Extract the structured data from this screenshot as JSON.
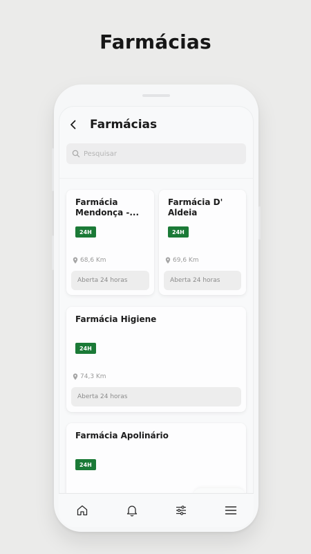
{
  "headline": "Farmácias",
  "app": {
    "title": "Farmácias",
    "search": {
      "placeholder": "Pesquisar",
      "value": ""
    }
  },
  "pharmacies": [
    {
      "name_line1": "Farmácia",
      "name_line2": "Mendonça -...",
      "badge": "24H",
      "distance": "68,6 Km",
      "status": "Aberta 24 horas"
    },
    {
      "name_line1": "Farmácia D'",
      "name_line2": "Aldeia",
      "badge": "24H",
      "distance": "69,6 Km",
      "status": "Aberta 24 horas"
    },
    {
      "name": "Farmácia Higiene",
      "badge": "24H",
      "distance": "74,3 Km",
      "status": "Aberta 24 horas"
    },
    {
      "name": "Farmácia Apolinário",
      "badge": "24H"
    }
  ],
  "icons": {
    "back": "back-arrow-icon",
    "search": "search-icon",
    "pin": "location-pin-icon",
    "nav": [
      "home-icon",
      "bell-icon",
      "filter-sliders-icon",
      "menu-icon"
    ]
  },
  "colors": {
    "badge": "#1b7a37",
    "background": "#ebebea",
    "screen": "#f8f9fa"
  }
}
